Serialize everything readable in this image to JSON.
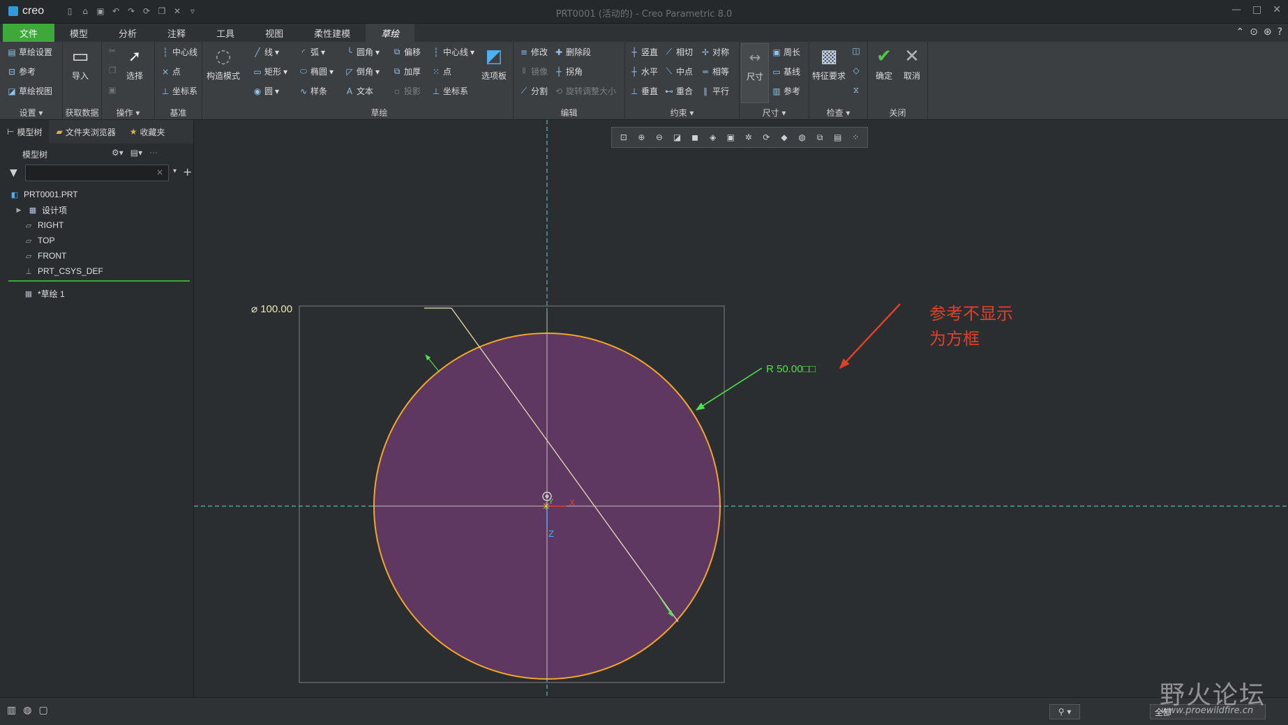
{
  "titlebar": {
    "logo": "creo",
    "window_title": "PRT0001 (活动的) - Creo Parametric 8.0"
  },
  "tabs": [
    {
      "label": "文件"
    },
    {
      "label": "模型"
    },
    {
      "label": "分析"
    },
    {
      "label": "注释"
    },
    {
      "label": "工具"
    },
    {
      "label": "视图"
    },
    {
      "label": "柔性建模"
    },
    {
      "label": "草绘"
    }
  ],
  "ribbon": {
    "setup": {
      "items": [
        "草绘设置",
        "参考",
        "草绘视图"
      ],
      "label": "设置"
    },
    "getdata": {
      "import": "导入",
      "label": "获取数据"
    },
    "operations": {
      "select": "选择",
      "label": "操作"
    },
    "datum": {
      "items": [
        "中心线",
        "点",
        "坐标系"
      ],
      "label": "基准"
    },
    "sketch": {
      "construction": "构造模式",
      "col1": [
        "线",
        "矩形",
        "圆"
      ],
      "col2": [
        "弧",
        "椭圆",
        "样条"
      ],
      "col3": [
        "圆角",
        "倒角",
        "文本"
      ],
      "col4": [
        "偏移",
        "加厚",
        "投影"
      ],
      "col5": [
        "中心线",
        "点",
        "坐标系"
      ],
      "palette": "选项板",
      "label": "草绘"
    },
    "edit": {
      "col1": [
        "修改",
        "镜像",
        "分割"
      ],
      "col2": [
        "删除段",
        "拐角",
        "旋转调整大小"
      ],
      "label": "编辑"
    },
    "constrain": {
      "col1": [
        "竖直",
        "水平",
        "垂直"
      ],
      "col2": [
        "相切",
        "中点",
        "重合"
      ],
      "col3": [
        "对称",
        "相等",
        "平行"
      ],
      "label": "约束"
    },
    "dimension": {
      "dim": "尺寸",
      "items": [
        "周长",
        "基线",
        "参考"
      ],
      "label": "尺寸"
    },
    "inspect": {
      "feature_req": "特征要求",
      "label": "检查"
    },
    "close": {
      "ok": "确定",
      "cancel": "取消",
      "label": "关闭"
    }
  },
  "leftpanel": {
    "tabs": [
      "模型树",
      "文件夹浏览器",
      "收藏夹"
    ],
    "tree_header": "模型树",
    "filter_placeholder": "",
    "tree": [
      "PRT0001.PRT",
      "设计项",
      "RIGHT",
      "TOP",
      "FRONT",
      "PRT_CSYS_DEF"
    ],
    "sketch_node": "*草绘 1"
  },
  "graphics": {
    "dim_diameter": "⌀ 100.00",
    "dim_radius": "R 50.00",
    "box_glyph": "□□",
    "axis_x": "X",
    "axis_y": "Y",
    "axis_z": "Z",
    "annotation_line1": "参考不显示",
    "annotation_line2": "为方框",
    "colors": {
      "circle_fill": "#5f3862",
      "circle_stroke": "#f2a627",
      "dim_line": "#f0e6b8",
      "radius_dim": "#4fe04a",
      "axis_dash": "#6ad4d4",
      "annotation": "#e0402a"
    }
  },
  "statusbar": {
    "filter_value": "全部"
  },
  "watermark": {
    "chars": "野火论坛",
    "url": "www.proewildfire.cn"
  }
}
